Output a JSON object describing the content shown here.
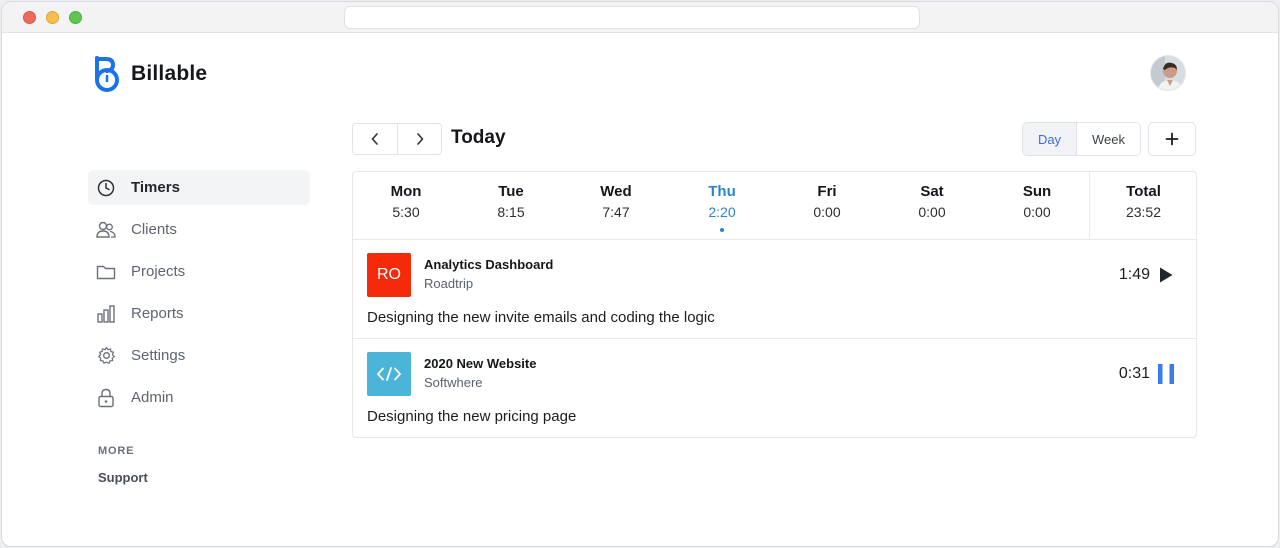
{
  "app": {
    "name": "Billable"
  },
  "sidebar": {
    "items": [
      {
        "label": "Timers",
        "icon": "clock-icon",
        "active": true
      },
      {
        "label": "Clients",
        "icon": "users-icon"
      },
      {
        "label": "Projects",
        "icon": "folder-icon"
      },
      {
        "label": "Reports",
        "icon": "bar-chart-icon"
      },
      {
        "label": "Settings",
        "icon": "gear-icon"
      },
      {
        "label": "Admin",
        "icon": "lock-icon"
      }
    ],
    "more_label": "MORE",
    "support_label": "Support"
  },
  "toolbar": {
    "title": "Today",
    "prev_icon": "chevron-left-icon",
    "next_icon": "chevron-right-icon",
    "view_day": "Day",
    "view_week": "Week",
    "add_label": "+"
  },
  "week": {
    "days": [
      {
        "name": "Mon",
        "time": "5:30"
      },
      {
        "name": "Tue",
        "time": "8:15"
      },
      {
        "name": "Wed",
        "time": "7:47"
      },
      {
        "name": "Thu",
        "time": "2:20",
        "current": true
      },
      {
        "name": "Fri",
        "time": "0:00"
      },
      {
        "name": "Sat",
        "time": "0:00"
      },
      {
        "name": "Sun",
        "time": "0:00"
      }
    ],
    "total": {
      "name": "Total",
      "time": "23:52"
    }
  },
  "entries": [
    {
      "badge": "RO",
      "badge_color": "#f52a0a",
      "title": "Analytics Dashboard",
      "client": "Roadtrip",
      "description": "Designing the new invite emails and coding the logic",
      "time": "1:49",
      "state": "play-icon"
    },
    {
      "badge_icon": "code-icon",
      "badge_color": "#4bb4d9",
      "title": "2020 New Website",
      "client": "Softwhere",
      "description": "Designing the new pricing page",
      "time": "0:31",
      "state": "pause-icon"
    }
  ],
  "colors": {
    "accent": "#3d6ee0",
    "today": "#2a87c7",
    "logo": "#1a73e8",
    "pause": "#3a7bf2"
  }
}
